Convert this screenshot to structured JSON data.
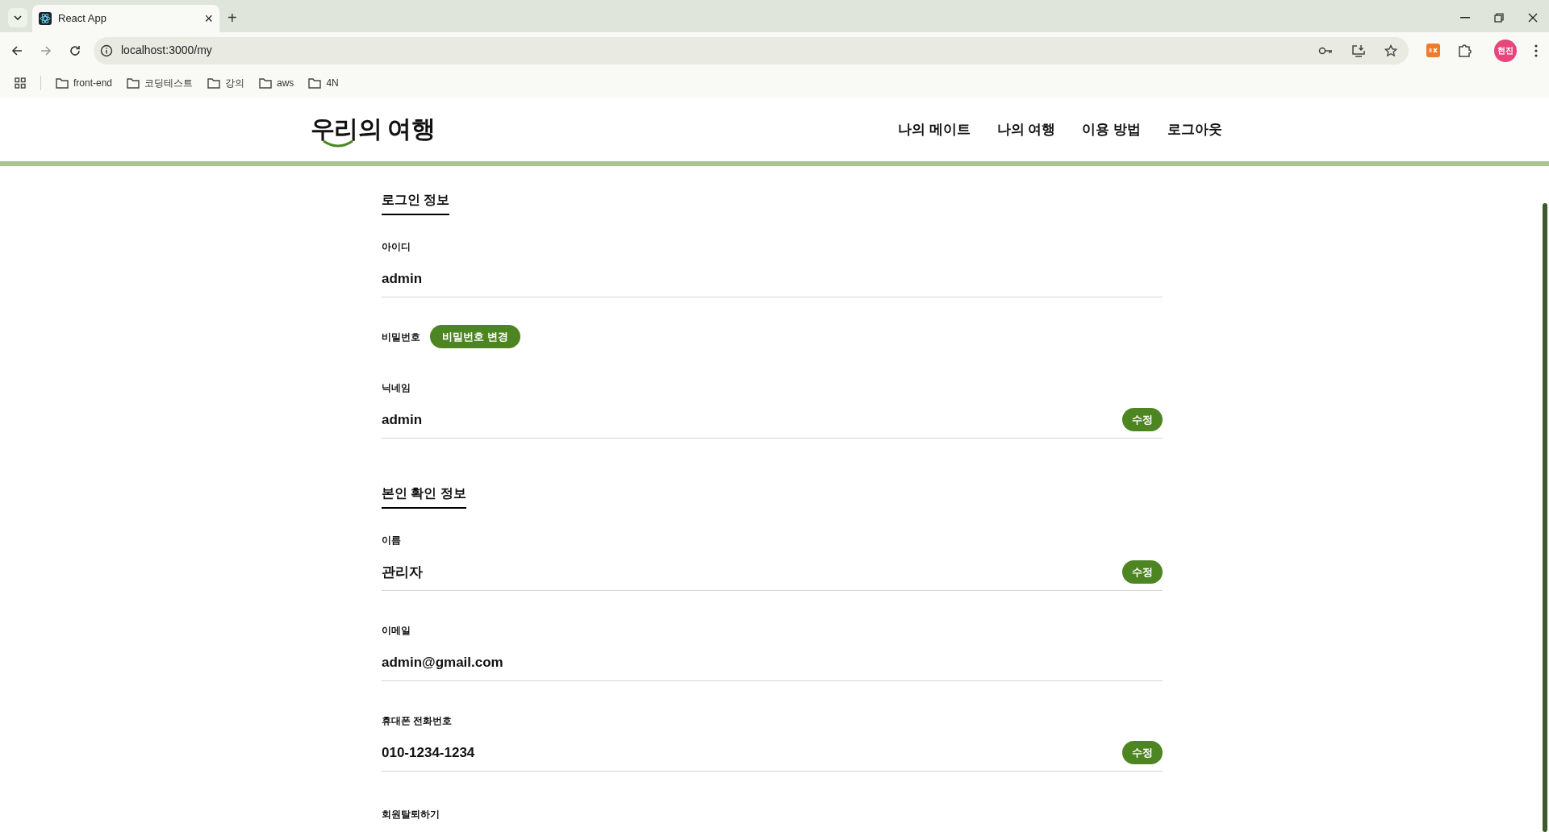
{
  "browser": {
    "tab": {
      "title": "React App",
      "close": "×"
    },
    "new_tab": "+",
    "address": "localhost:3000/my",
    "bookmarks": [
      {
        "label": "front-end"
      },
      {
        "label": "코딩테스트"
      },
      {
        "label": "강의"
      },
      {
        "label": "aws"
      },
      {
        "label": "4N"
      }
    ],
    "profile": "현진"
  },
  "header": {
    "logo": "우리의 여행",
    "nav": [
      "나의 메이트",
      "나의 여행",
      "이용 방법",
      "로그아웃"
    ]
  },
  "sections": [
    {
      "title": "로그인 정보",
      "fields": [
        {
          "kind": "value",
          "label": "아이디",
          "value": "admin"
        },
        {
          "kind": "button",
          "label": "비밀번호",
          "button": "비밀번호 변경"
        },
        {
          "kind": "value",
          "label": "닉네임",
          "value": "admin",
          "edit": "수정"
        }
      ]
    },
    {
      "title": "본인 확인 정보",
      "fields": [
        {
          "kind": "value",
          "label": "이름",
          "value": "관리자",
          "edit": "수정"
        },
        {
          "kind": "value",
          "label": "이메일",
          "value": "admin@gmail.com"
        },
        {
          "kind": "value",
          "label": "휴대폰 전화번호",
          "value": "010-1234-1234",
          "edit": "수정"
        }
      ]
    }
  ],
  "withdraw": "회원탈퇴하기"
}
